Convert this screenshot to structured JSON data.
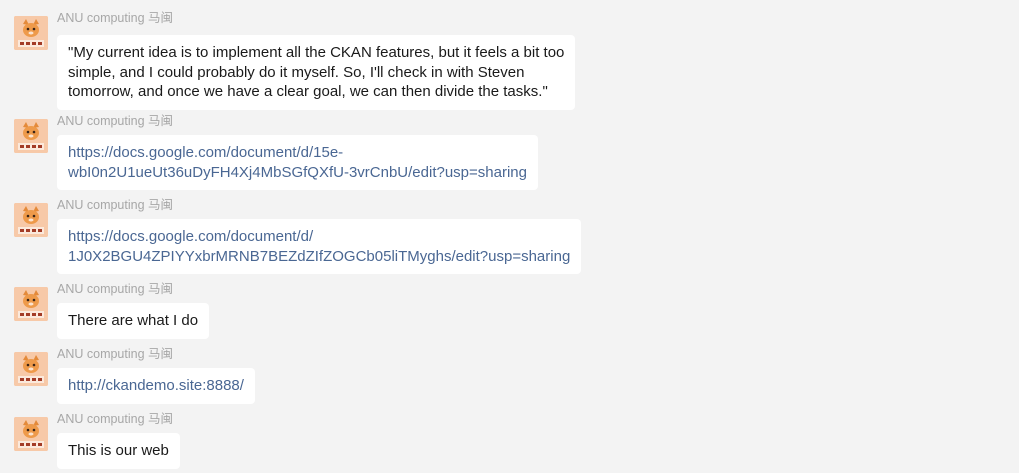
{
  "chat": {
    "messages": [
      {
        "sender": "ANU computing 马闽",
        "type": "text",
        "lines": [
          "\"My current idea is to implement all the CKAN features, but it feels a bit too",
          "simple, and I could probably do it myself. So, I'll check in with Steven",
          "tomorrow, and once we have a clear goal, we can then divide the tasks.\""
        ]
      },
      {
        "sender": "ANU computing 马闽",
        "type": "link",
        "lines": [
          "https://docs.google.com/document/d/15e-",
          "wbI0n2U1ueUt36uDyFH4Xj4MbSGfQXfU-3vrCnbU/edit?usp=sharing"
        ]
      },
      {
        "sender": "ANU computing 马闽",
        "type": "link",
        "lines": [
          "https://docs.google.com/document/d/",
          "1J0X2BGU4ZPIYYxbrMRNB7BEZdZIfZOGCb05liTMyghs/edit?usp=sharing"
        ]
      },
      {
        "sender": "ANU computing 马闽",
        "type": "text",
        "lines": [
          "There are what I do"
        ]
      },
      {
        "sender": "ANU computing 马闽",
        "type": "link",
        "lines": [
          "http://ckandemo.site:8888/"
        ]
      },
      {
        "sender": "ANU computing 马闽",
        "type": "text",
        "lines": [
          "This is our web"
        ]
      }
    ]
  },
  "colors": {
    "background": "#f3f3f3",
    "bubble": "#ffffff",
    "link": "#4a6793",
    "sender": "#a7a7a7"
  }
}
